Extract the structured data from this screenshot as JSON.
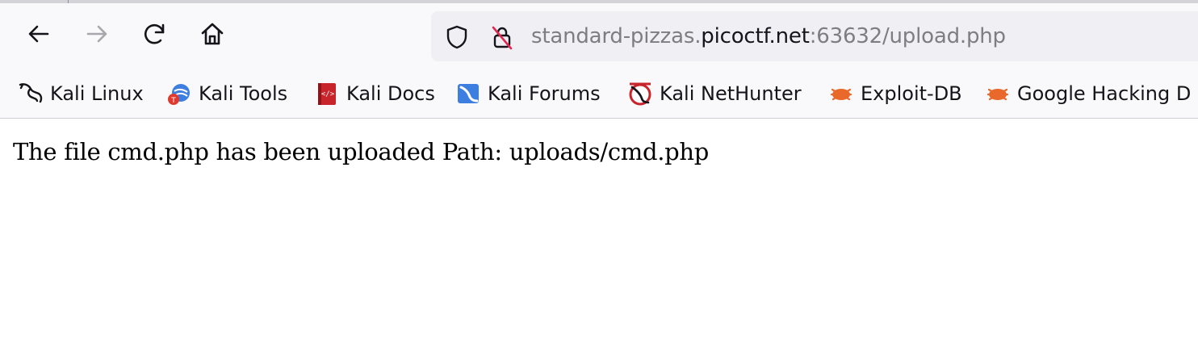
{
  "toolbar": {
    "back_icon": "arrow-left-icon",
    "forward_icon": "arrow-right-icon",
    "reload_icon": "reload-icon",
    "home_icon": "home-icon"
  },
  "urlbar": {
    "security_icon": "shield-icon",
    "insecure_icon": "insecure-lock-icon",
    "url_prefix": "standard-pizzas.",
    "url_domain": "picoctf.net",
    "url_suffix": ":63632/upload.php"
  },
  "bookmarks": {
    "items": [
      {
        "label": "Kali Linux",
        "icon": "kali-dragon-icon"
      },
      {
        "label": "Kali Tools",
        "icon": "kali-tools-icon"
      },
      {
        "label": "Kali Docs",
        "icon": "kali-docs-icon"
      },
      {
        "label": "Kali Forums",
        "icon": "kali-forums-icon"
      },
      {
        "label": "Kali NetHunter",
        "icon": "kali-nethunter-icon"
      },
      {
        "label": "Exploit-DB",
        "icon": "exploit-db-icon"
      },
      {
        "label": "Google Hacking D",
        "icon": "exploit-db-icon"
      }
    ]
  },
  "page": {
    "message": "The file cmd.php has been uploaded Path: uploads/cmd.php"
  },
  "colors": {
    "toolbar_bg": "#f9f9fb",
    "urlbar_bg": "#f0f0f4",
    "text": "#15141a",
    "dim_text": "#7d7d82",
    "exploit_orange": "#e8692a"
  }
}
